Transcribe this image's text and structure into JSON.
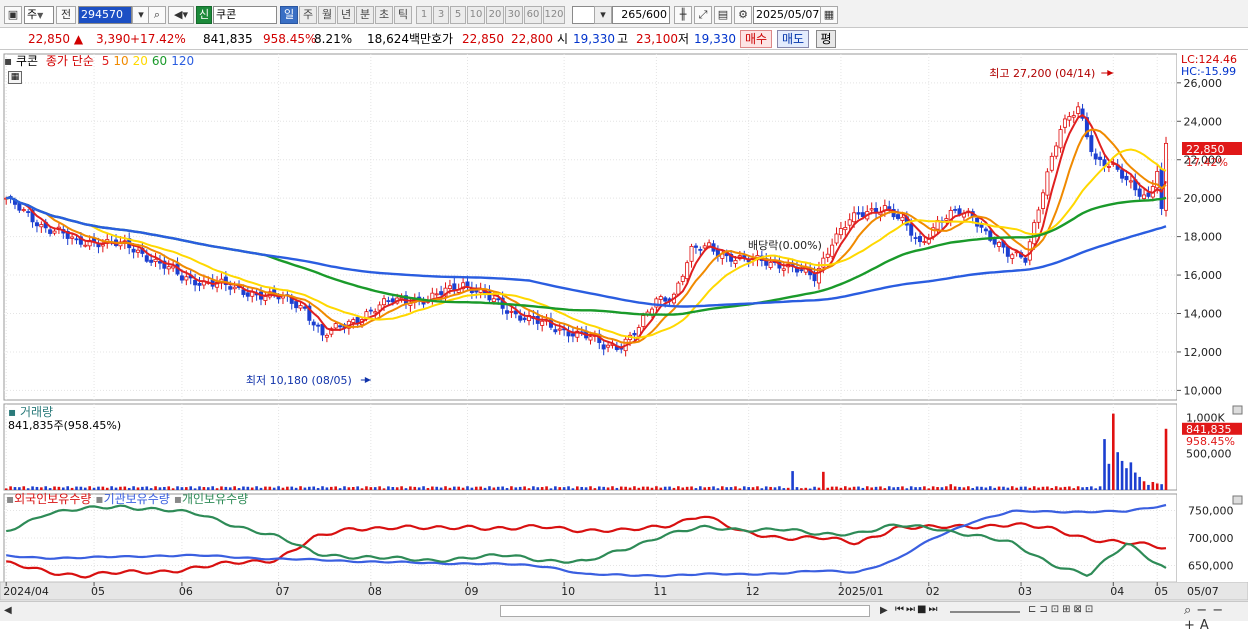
{
  "toolbar": {
    "market_sel": "주",
    "jeon_btn": "전",
    "code_value": "294570",
    "name_badge": "신",
    "name_value": "쿠콘",
    "period_tabs": [
      "일",
      "주",
      "월",
      "년",
      "분",
      "초",
      "틱"
    ],
    "period_active": 0,
    "num_tabs": [
      "1",
      "3",
      "5",
      "10",
      "20",
      "30",
      "60",
      "120"
    ],
    "count_value": "265",
    "count_total": "/600",
    "date_value": "2025/05/07"
  },
  "quote": {
    "price": "22,850",
    "arrow": "▲",
    "change": "3,390",
    "change_pct": "+17.42%",
    "volume": "841,835",
    "volume_pct": "958.45%",
    "turnover": "8.21%",
    "amount": "18,624백만",
    "hoga_label": "호가",
    "ask": "22,850",
    "bid": "22,800",
    "open_label": "시",
    "open": "19,330",
    "high_label": "고",
    "high": "23,100",
    "low_label": "저",
    "low": "19,330",
    "buy_btn": "매수",
    "sell_btn": "매도",
    "eval_btn": "평"
  },
  "price_panel": {
    "name": "쿠콘",
    "legend_prefix": "종가 단순",
    "ma_periods": [
      "5",
      "10",
      "20",
      "60",
      "120"
    ],
    "ma_colors": [
      "#e02020",
      "#f08a00",
      "#ffd800",
      "#1a9a2a",
      "#2a5de0"
    ],
    "lc": "LC:124.46",
    "hc": "HC:-15.99",
    "high_note": "최고 27,200 (04/14)",
    "low_note": "최저 10,180 (08/05)",
    "event_note": "배당락(0.00%)",
    "last_price_tag": "22,850",
    "last_pct_tag": "17.42%",
    "y_ticks": [
      "26,000",
      "24,000",
      "22,000",
      "20,000",
      "18,000",
      "16,000",
      "14,000",
      "12,000",
      "10,000"
    ]
  },
  "volume_panel": {
    "title": "거래량",
    "value": "841,835주(958.45%)",
    "y_ticks": [
      "1,000K",
      "500,000"
    ],
    "last_tag": "841,835",
    "last_pct": "958.45%"
  },
  "holding_panel": {
    "series": [
      "외국인보유수량",
      "기관보유수량",
      "개인보유수량"
    ],
    "colors": [
      "#d81010",
      "#3a5fe0",
      "#2e8b57"
    ],
    "y_ticks": [
      "750,000",
      "700,000",
      "650,000"
    ]
  },
  "x_axis": {
    "labels": [
      "2024/04",
      "05",
      "06",
      "07",
      "08",
      "09",
      "10",
      "11",
      "12",
      "2025/01",
      "02",
      "03",
      "04",
      "05"
    ],
    "right_label": "05/07"
  },
  "chart_data": {
    "type": "candlestick",
    "ylim": [
      9500,
      27500
    ],
    "weekly_close": [
      20000,
      19200,
      18600,
      18300,
      17600,
      17800,
      17700,
      17400,
      17000,
      16500,
      15800,
      15700,
      15600,
      15200,
      15100,
      14900,
      14700,
      14300,
      12800,
      13300,
      13800,
      14200,
      14700,
      14800,
      14600,
      15200,
      15600,
      15000,
      14500,
      14000,
      13600,
      13300,
      13100,
      12800,
      12300,
      12400,
      13200,
      14700,
      15000,
      17200,
      17500,
      17000,
      16700,
      16800,
      16600,
      16200,
      15900,
      17800,
      18800,
      19300,
      19600,
      18700,
      17600,
      18800,
      19200,
      19100,
      18000,
      17000,
      16900,
      20500,
      23500,
      24800,
      22000,
      21500,
      20800,
      20000,
      22850
    ]
  }
}
